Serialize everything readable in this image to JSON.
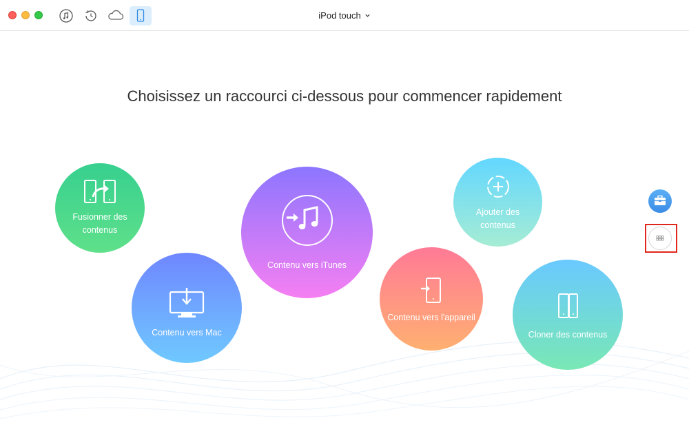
{
  "window": {
    "device_name": "iPod touch"
  },
  "toolbar": {
    "icons": [
      "music-icon",
      "history-icon",
      "cloud-icon",
      "device-icon"
    ],
    "active": "device-icon"
  },
  "main": {
    "headline": "Choisissez un raccourci ci-dessous pour commencer rapidement",
    "shortcuts": {
      "fusion": {
        "line1": "Fusionner des",
        "line2": "contenus",
        "icon": "merge-devices-icon",
        "colors": [
          "#36d08f",
          "#5fe08a"
        ]
      },
      "mac": {
        "label": "Contenu vers Mac",
        "icon": "monitor-download-icon",
        "colors": [
          "#6f86ff",
          "#6fc9ff"
        ]
      },
      "itunes": {
        "label": "Contenu vers iTunes",
        "icon": "itunes-music-icon",
        "colors": [
          "#8c76ff",
          "#f67ff2"
        ]
      },
      "appareil": {
        "label": "Contenu vers l'appareil",
        "icon": "device-import-icon",
        "colors": [
          "#ff7a96",
          "#ffb071"
        ]
      },
      "ajouter": {
        "line1": "Ajouter des",
        "line2": "contenus",
        "icon": "add-circle-icon",
        "colors": [
          "#62d7ff",
          "#a6ecd4"
        ]
      },
      "cloner": {
        "label": "Cloner des contenus",
        "icon": "clone-devices-icon",
        "colors": [
          "#6ac9ff",
          "#79e8b5"
        ]
      }
    }
  },
  "sidebar": {
    "buttons": [
      "toolkit-icon",
      "grid-icon"
    ],
    "highlight_color": "#e0271b"
  }
}
